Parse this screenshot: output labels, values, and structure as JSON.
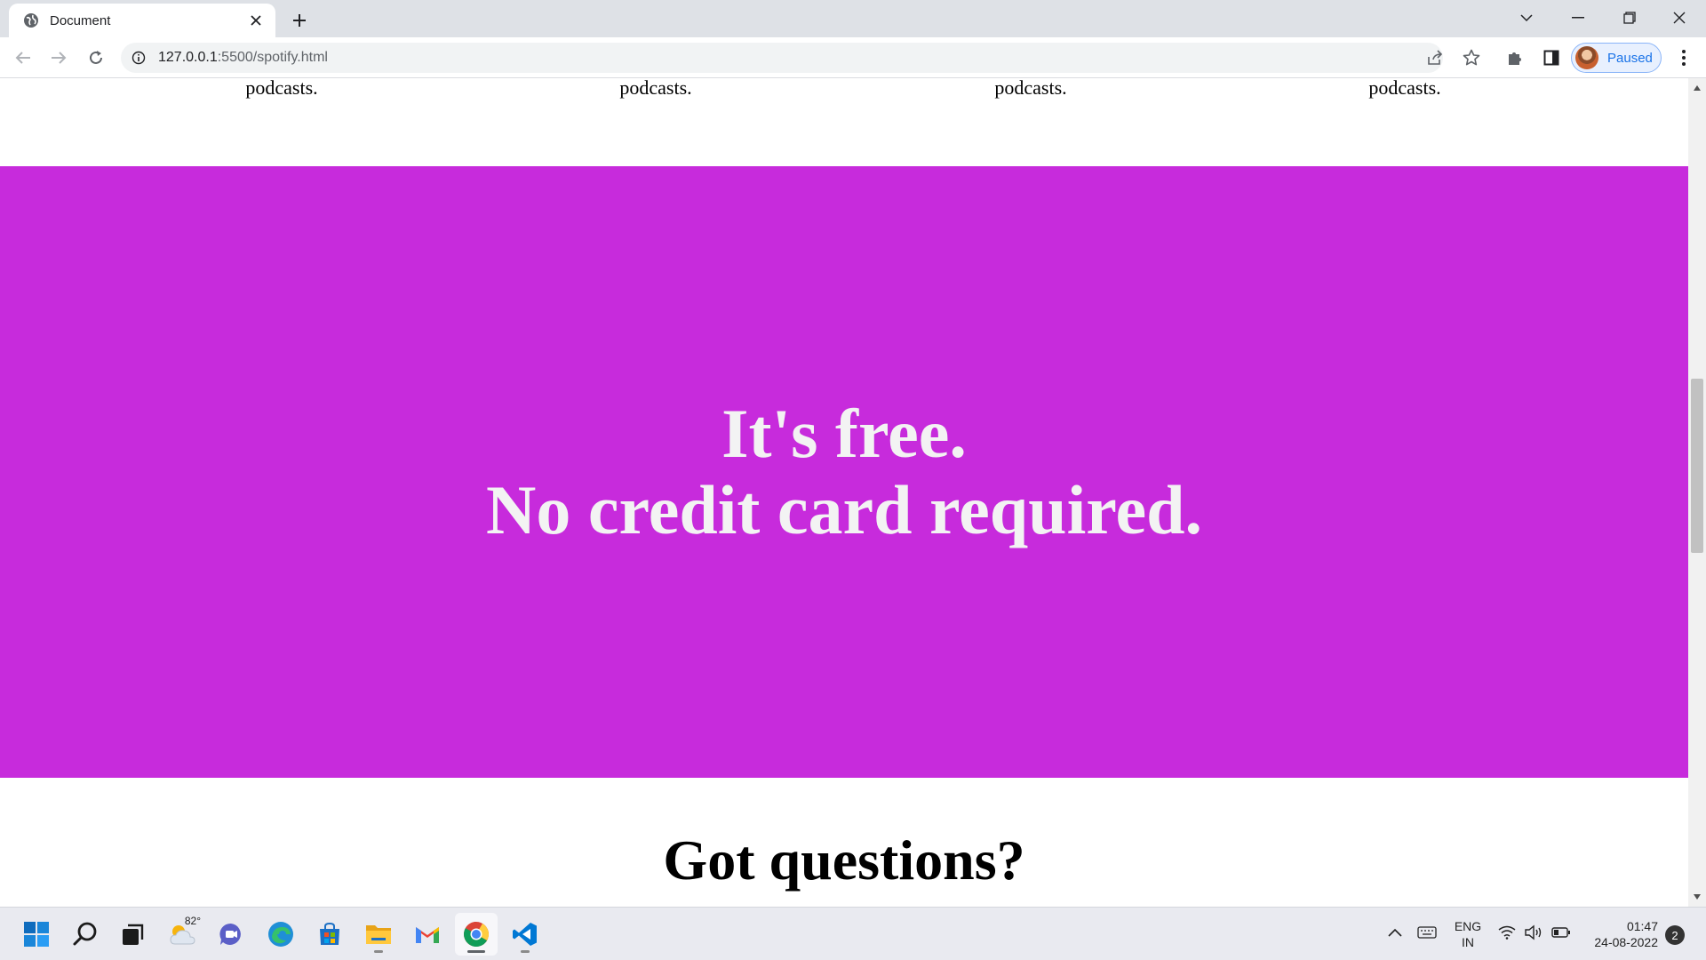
{
  "browser": {
    "tab_title": "Document",
    "url_host": "127.0.0.1",
    "url_rest": ":5500/spotify.html",
    "profile_label": "Paused",
    "accent": "#1a73e8"
  },
  "page": {
    "features": [
      "podcasts.",
      "podcasts.",
      "podcasts.",
      "podcasts."
    ],
    "promo": {
      "line1": "It's free.",
      "line2": "No credit card required.",
      "background": "#c72bdc"
    },
    "faq_heading": "Got questions?"
  },
  "taskbar": {
    "apps": [
      "start-icon",
      "search-icon",
      "task-view-icon",
      "weather-icon",
      "teams-chat-icon",
      "edge-icon",
      "store-icon",
      "file-explorer-icon",
      "gmail-icon",
      "chrome-icon",
      "vscode-icon"
    ],
    "weather_temp": "82°",
    "language_line1": "ENG",
    "language_line2": "IN",
    "time": "01:47",
    "date": "24-08-2022",
    "notification_count": "2"
  }
}
